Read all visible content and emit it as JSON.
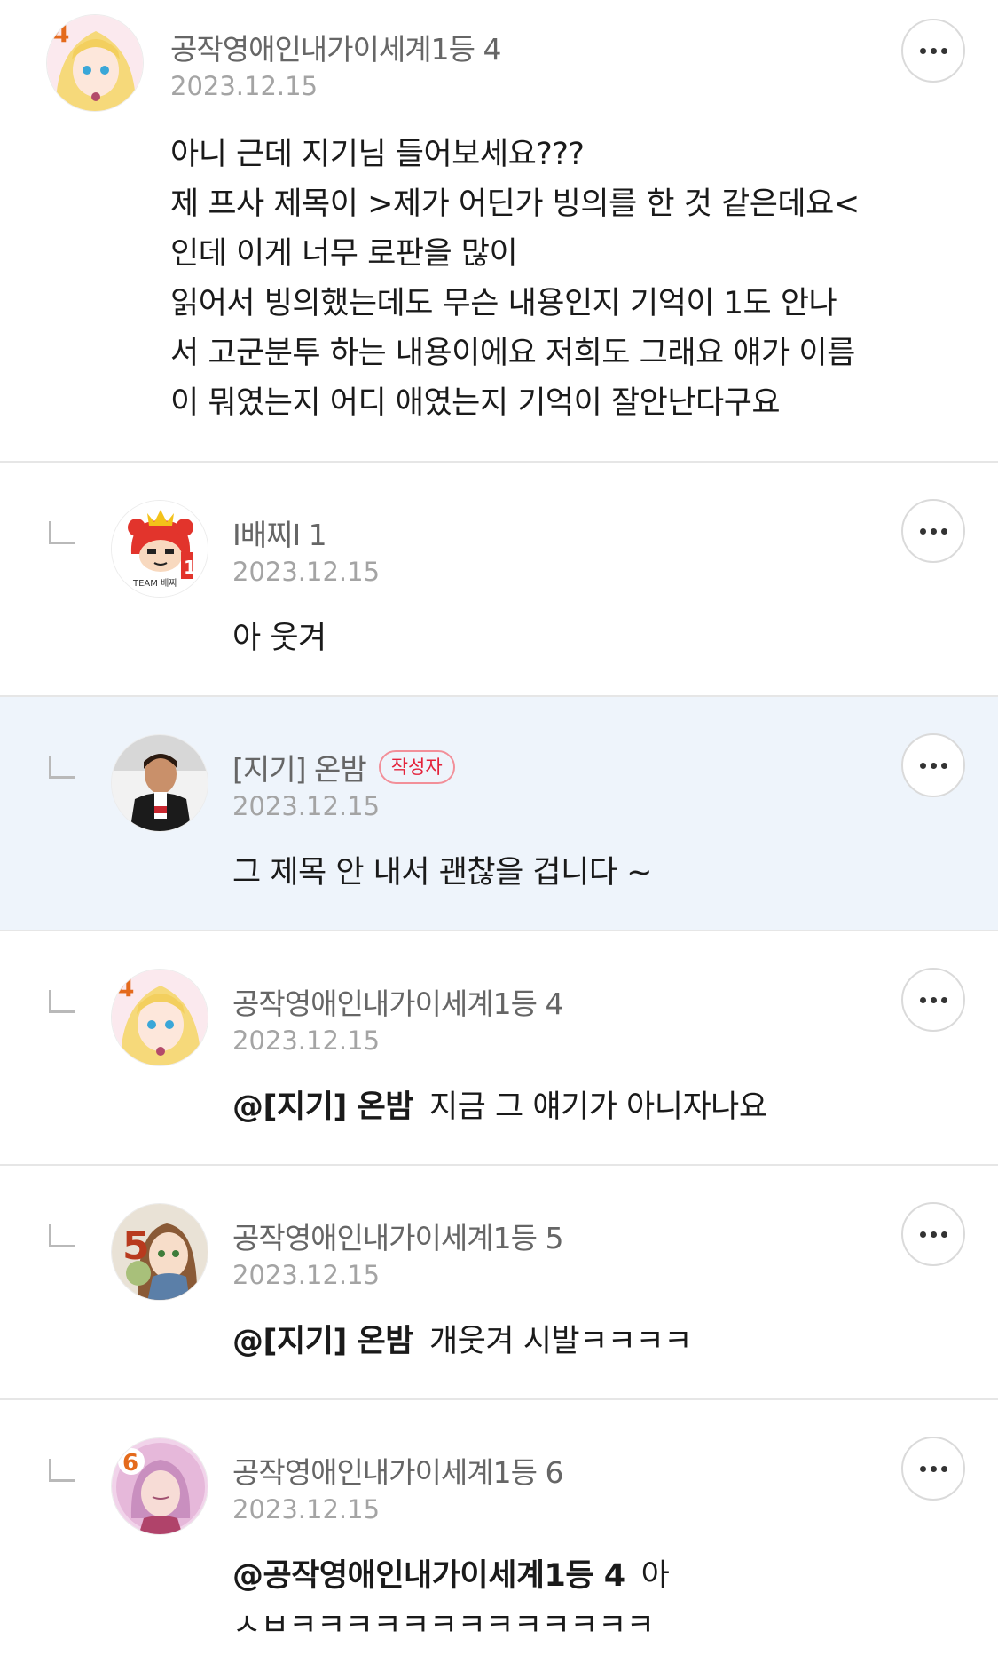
{
  "comments": [
    {
      "nickname": "공작영애인내가이세계1등 4",
      "date": "2023.12.15",
      "lines": [
        "아니 근데 지기님 들어보세요???",
        "제 프사 제목이 >제가 어딘가 빙의를 한 것 같은데요<",
        "인데 이게 너무 로판을 많이",
        "읽어서 빙의했는데도 무슨 내용인지 기억이 1도 안나",
        "서 고군분투 하는 내용이에요 저희도 그래요 얘가 이름",
        "이 뭐였는지 어디 애였는지 기억이 잘안난다구요"
      ]
    },
    {
      "nickname": "I배찌I 1",
      "date": "2023.12.15",
      "text": "아 웃겨"
    },
    {
      "nickname": "[지기] 온밤",
      "badge": "작성자",
      "date": "2023.12.15",
      "text": "그 제목 안 내서 괜찮을 겁니다 ~"
    },
    {
      "nickname": "공작영애인내가이세계1등 4",
      "date": "2023.12.15",
      "mention": "@[지기] 온밤",
      "text": "지금 그 얘기가 아니자나요"
    },
    {
      "nickname": "공작영애인내가이세계1등 5",
      "date": "2023.12.15",
      "mention": "@[지기] 온밤",
      "text": "개웃겨 시발ㅋㅋㅋㅋ"
    },
    {
      "nickname": "공작영애인내가이세계1등 6",
      "date": "2023.12.15",
      "mention": "@공작영애인내가이세계1등 4",
      "text": "아",
      "text2": "ㅅㅂㅋㅋㅋㅋㅋㅋㅋㅋㅋㅋㅋㅋㅋ"
    }
  ],
  "avatar_badges": [
    "4",
    "1",
    "4",
    "5",
    "6"
  ],
  "avatar_team_text": "TEAM 배찌",
  "icons": {
    "more": "more-horizontal-icon",
    "reply": "reply-arrow-icon"
  },
  "colors": {
    "highlight_bg": "#eef4fb",
    "badge_red": "#e4233b",
    "nick_gray": "#666666",
    "date_gray": "#a4a4a4"
  }
}
